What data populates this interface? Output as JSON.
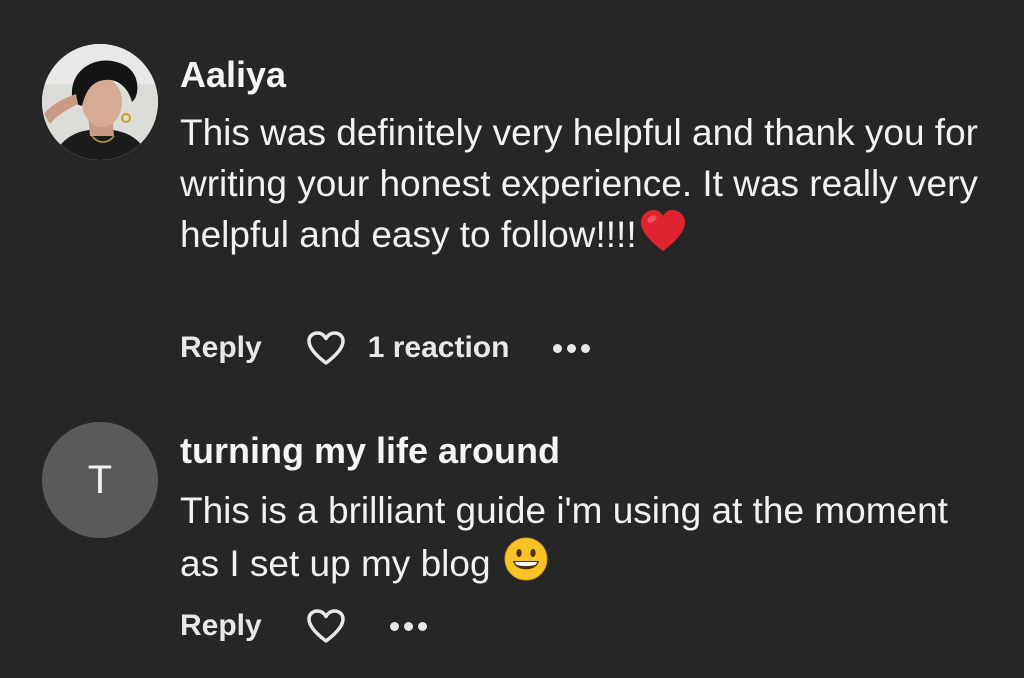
{
  "comments": [
    {
      "author": "Aaliya",
      "avatar_type": "photo",
      "text": "This was definitely very helpful and thank you for writing your honest experience. It was really very helpful and easy to follow!!!!",
      "text_emoji": "red-heart-icon",
      "reply_label": "Reply",
      "reaction_count": "1 reaction"
    },
    {
      "author": "turning my life around",
      "avatar_type": "letter",
      "avatar_letter": "T",
      "text": "This is a brilliant guide i'm using at the moment as I set up my blog",
      "text_emoji": "grinning-face-icon",
      "reply_label": "Reply",
      "reaction_count": ""
    }
  ],
  "colors": {
    "background": "#262626",
    "text": "#f2f2f2",
    "avatar_letter_bg": "#5a5a5a",
    "heart_red": "#e0242f",
    "emoji_yellow": "#f7c325"
  }
}
